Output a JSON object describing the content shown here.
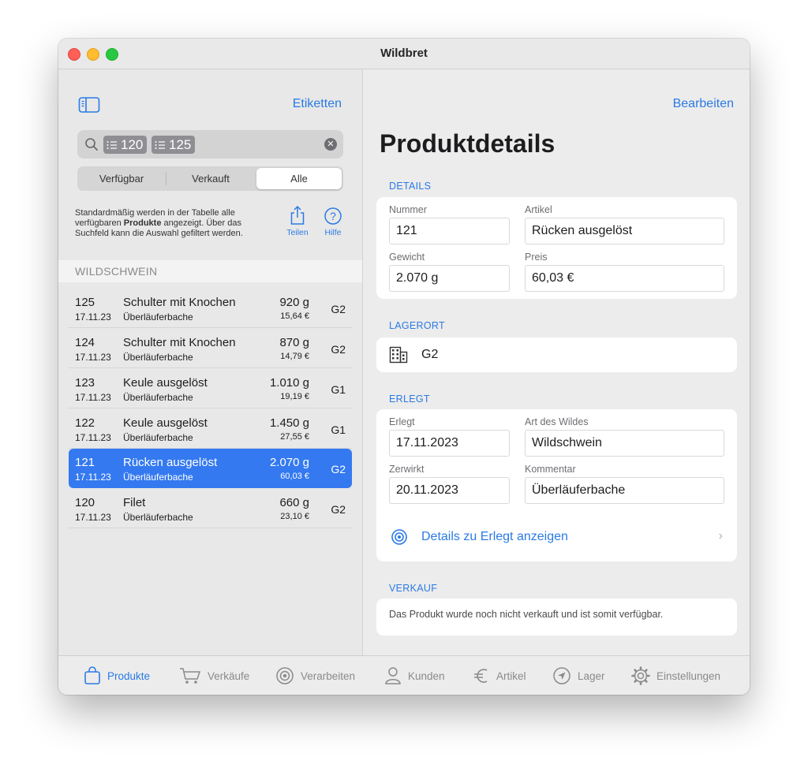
{
  "window": {
    "title": "Wildbret"
  },
  "sidebar": {
    "labels_button": "Etiketten",
    "search": {
      "tokens": [
        "120",
        "125"
      ]
    },
    "filter": {
      "options": [
        "Verfügbar",
        "Verkauft",
        "Alle"
      ],
      "selected": "Alle"
    },
    "info": {
      "prefix": "Standardmäßig werden in der Tabelle alle verfügbaren ",
      "bold": "Produkte",
      "suffix": " angezeigt. Über das Suchfeld kann die Auswahl gefiltert werden."
    },
    "share_label": "Teilen",
    "help_label": "Hilfe",
    "section": "WILDSCHWEIN",
    "rows": [
      {
        "number": "125",
        "date": "17.11.23",
        "name": "Schulter mit Knochen",
        "sub": "Überläuferbache",
        "weight": "920 g",
        "price": "15,64 €",
        "location": "G2"
      },
      {
        "number": "124",
        "date": "17.11.23",
        "name": "Schulter mit Knochen",
        "sub": "Überläuferbache",
        "weight": "870 g",
        "price": "14,79 €",
        "location": "G2"
      },
      {
        "number": "123",
        "date": "17.11.23",
        "name": "Keule ausgelöst",
        "sub": "Überläuferbache",
        "weight": "1.010 g",
        "price": "19,19 €",
        "location": "G1"
      },
      {
        "number": "122",
        "date": "17.11.23",
        "name": "Keule ausgelöst",
        "sub": "Überläuferbache",
        "weight": "1.450 g",
        "price": "27,55 €",
        "location": "G1"
      },
      {
        "number": "121",
        "date": "17.11.23",
        "name": "Rücken ausgelöst",
        "sub": "Überläuferbache",
        "weight": "2.070 g",
        "price": "60,03 €",
        "location": "G2"
      },
      {
        "number": "120",
        "date": "17.11.23",
        "name": "Filet",
        "sub": "Überläuferbache",
        "weight": "660 g",
        "price": "23,10 €",
        "location": "G2"
      }
    ]
  },
  "main": {
    "edit_button": "Bearbeiten",
    "title": "Produktdetails",
    "details": {
      "label": "DETAILS",
      "number_label": "Nummer",
      "number": "121",
      "article_label": "Artikel",
      "article": "Rücken ausgelöst",
      "weight_label": "Gewicht",
      "weight": "2.070 g",
      "price_label": "Preis",
      "price": "60,03 €"
    },
    "storage": {
      "label": "LAGERORT",
      "value": "G2"
    },
    "hunted": {
      "label": "ERLEGT",
      "hunted_label": "Erlegt",
      "hunted": "17.11.2023",
      "game_label": "Art des Wildes",
      "game": "Wildschwein",
      "processed_label": "Zerwirkt",
      "processed": "20.11.2023",
      "comment_label": "Kommentar",
      "comment": "Überläuferbache",
      "link": "Details zu Erlegt anzeigen"
    },
    "sale": {
      "label": "VERKAUF",
      "note": "Das Produkt wurde noch nicht verkauft und ist somit verfügbar."
    }
  },
  "tabs": [
    {
      "label": "Produkte",
      "icon": "bag-icon"
    },
    {
      "label": "Verkäufe",
      "icon": "cart-icon"
    },
    {
      "label": "Verarbeiten",
      "icon": "target-icon"
    },
    {
      "label": "Kunden",
      "icon": "person-icon"
    },
    {
      "label": "Artikel",
      "icon": "euro-icon"
    },
    {
      "label": "Lager",
      "icon": "location-icon"
    },
    {
      "label": "Einstellungen",
      "icon": "gear-icon"
    }
  ],
  "colors": {
    "accent": "#2a7ae4",
    "selection": "#3479f0"
  }
}
